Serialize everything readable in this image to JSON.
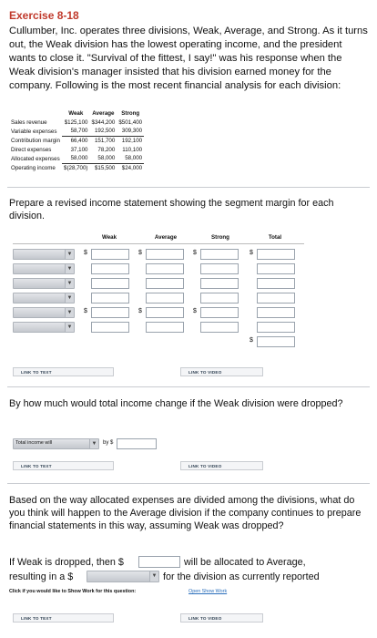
{
  "title": "Exercise 8-18",
  "intro": "Cullumber, Inc. operates three divisions, Weak, Average, and Strong. As it turns out, the Weak division has the lowest operating income, and the president wants to close it. \"Survival of the fittest, I say!\" was his response when the Weak division's manager insisted that his division earned money for the company. Following is the most recent financial analysis for each division:",
  "fin_table": {
    "headers": [
      "Weak",
      "Average",
      "Strong"
    ],
    "rows": [
      {
        "label": "Sales revenue",
        "values": [
          "$125,100",
          "$344,200",
          "$501,400"
        ]
      },
      {
        "label": "Variable expenses",
        "values": [
          "58,700",
          "192,500",
          "309,300"
        ]
      },
      {
        "label": "Contribution margin",
        "values": [
          "66,400",
          "151,700",
          "192,100"
        ]
      },
      {
        "label": "Direct expenses",
        "values": [
          "37,100",
          "78,200",
          "110,100"
        ]
      },
      {
        "label": "Allocated expenses",
        "values": [
          "58,000",
          "58,000",
          "58,000"
        ]
      },
      {
        "label": "Operating income",
        "values": [
          "$(28,700)",
          "$15,500",
          "$24,000"
        ]
      }
    ]
  },
  "q1": {
    "prompt": "Prepare a revised income statement showing the segment margin for each division.",
    "columns": [
      "Weak",
      "Average",
      "Strong",
      "Total"
    ],
    "dollar": "$"
  },
  "buttons": {
    "link_to_text": "LINK TO TEXT",
    "link_to_video": "LINK TO VIDEO"
  },
  "q2": {
    "prompt": "By how much would total income change if the Weak division were dropped?",
    "select_value": "Total income will",
    "by_label": "by $"
  },
  "q3": {
    "prompt": "Based on the way allocated expenses are divided among the divisions, what do you think will happen to the Average division if the company continues to prepare financial statements in this way, assuming Weak was dropped?",
    "line1_prefix": "If Weak is dropped, then $",
    "line1_suffix": "will be allocated to Average,",
    "line2_prefix": "resulting in a $",
    "line2_suffix": "for the division as currently reported",
    "show_work_label": "Click if you would like to Show Work for this question:",
    "show_work_link": "Open Show Work"
  }
}
